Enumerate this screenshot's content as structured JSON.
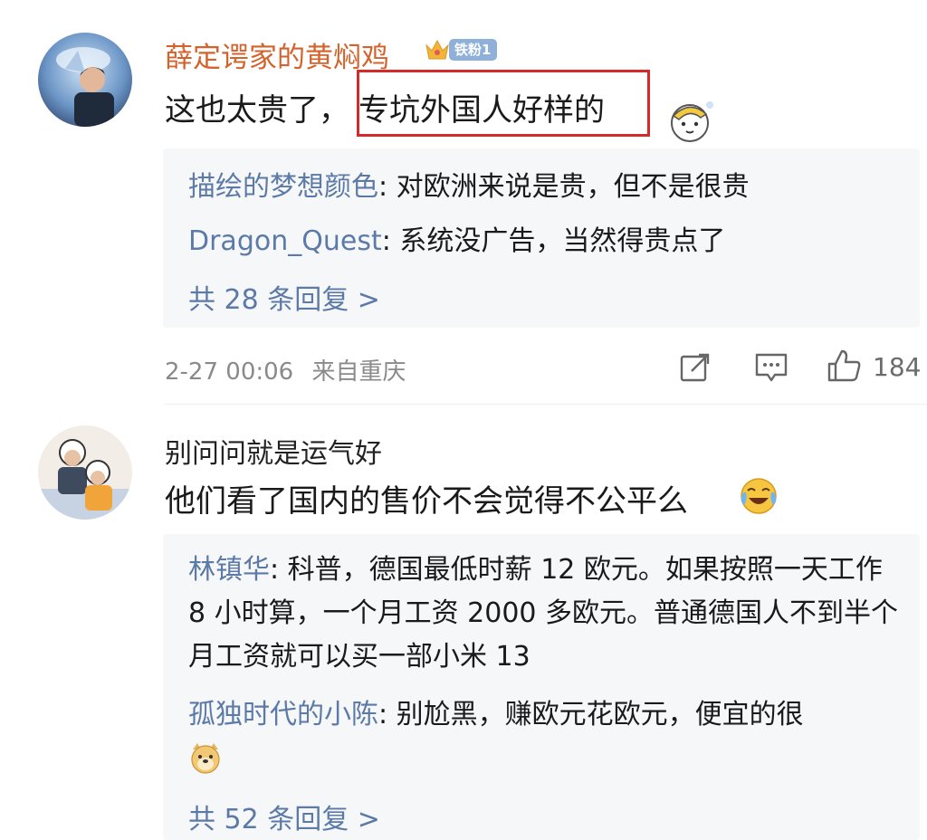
{
  "comments": [
    {
      "username": "薛定谔家的黄焖鸡",
      "badge": "铁粉1",
      "text_before": "这也太贵了，",
      "text_highlight": "专坑外国人好样的",
      "replies": [
        {
          "user": "描绘的梦想颜色",
          "text": "对欧洲来说是贵，但不是很贵"
        },
        {
          "user": "Dragon_Quest",
          "text": "系统没广告，当然得贵点了"
        }
      ],
      "more_replies": "共 28 条回复 >",
      "timestamp": "2-27 00:06",
      "location": "来自重庆",
      "likes": "184",
      "icons": [
        "share-icon",
        "comment-icon",
        "like-icon"
      ]
    },
    {
      "username": "别问问就是运气好",
      "text": "他们看了国内的售价不会觉得不公平么",
      "replies": [
        {
          "user": "林镇华",
          "text": "科普，德国最低时薪 12 欧元。如果按照一天工作 8 小时算，一个月工资 2000 多欧元。普通德国人不到半个月工资就可以买一部小米 13"
        },
        {
          "user": "孤独时代的小陈",
          "text": "别尬黑，赚欧元花欧元，便宜的很"
        }
      ],
      "more_replies": "共 52 条回复 >"
    }
  ],
  "colors": {
    "username_vip": "#d4622b",
    "reply_name": "#5c7aa8",
    "highlight_border": "#d42a2a",
    "panel_bg": "#f6f7f9"
  }
}
